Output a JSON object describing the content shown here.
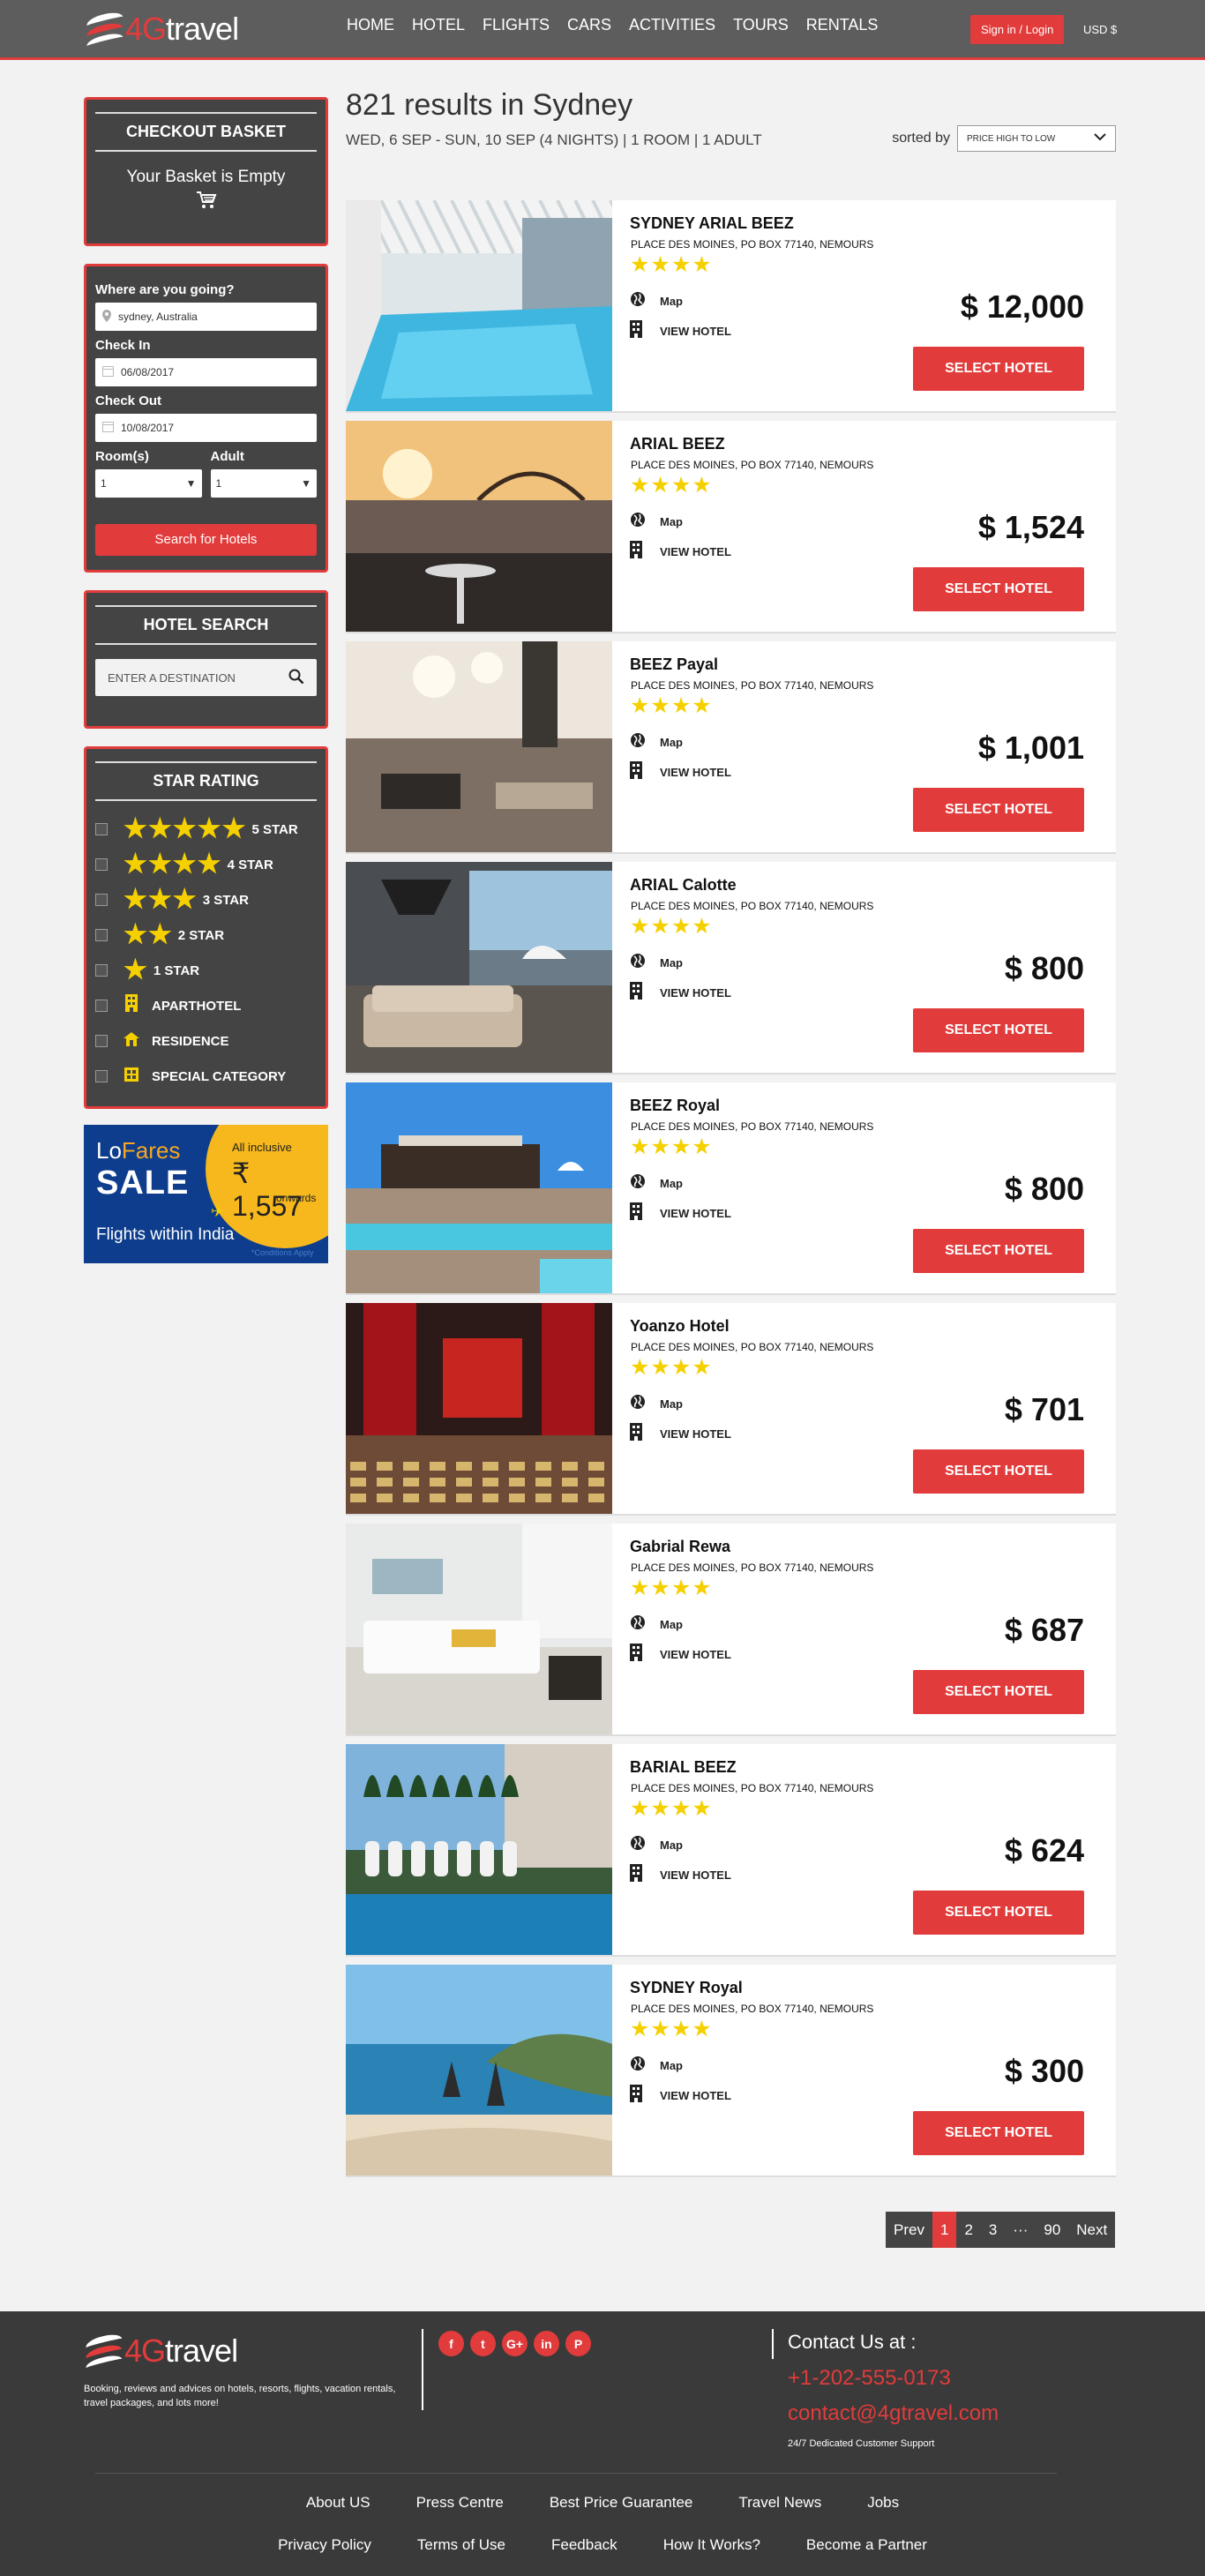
{
  "header": {
    "logo_prefix": "4G",
    "logo_suffix": "travel",
    "nav": [
      "HOME",
      "HOTEL",
      "FLIGHTS",
      "CARS",
      "ACTIVITIES",
      "TOURS",
      "RENTALS"
    ],
    "signin": "Sign in / Login",
    "currency": "USD $"
  },
  "basket": {
    "title": "CHECKOUT BASKET",
    "empty": "Your Basket is Empty"
  },
  "search": {
    "where_label": "Where are you going?",
    "where_value": "sydney, Australia",
    "checkin_label": "Check In",
    "checkin_value": "06/08/2017",
    "checkout_label": "Check Out",
    "checkout_value": "10/08/2017",
    "rooms_label": "Room(s)",
    "rooms_value": "1",
    "adult_label": "Adult",
    "adult_value": "1",
    "button": "Search for Hotels"
  },
  "hotel_search": {
    "title": "HOTEL SEARCH",
    "placeholder": "ENTER A DESTINATION"
  },
  "star_rating": {
    "title": "STAR RATING",
    "options": [
      {
        "label": "5 STAR",
        "stars": "★★★★★"
      },
      {
        "label": "4 STAR",
        "stars": "★★★★"
      },
      {
        "label": "3 STAR",
        "stars": "★★★"
      },
      {
        "label": "2 STAR",
        "stars": "★★"
      },
      {
        "label": "1 STAR",
        "stars": "★"
      }
    ],
    "categories": [
      {
        "label": "APARTHOTEL",
        "icon": "building-icon"
      },
      {
        "label": "RESIDENCE",
        "icon": "house-icon"
      },
      {
        "label": "SPECIAL CATEGORY",
        "icon": "grid-icon"
      }
    ]
  },
  "ad": {
    "brand_lo": "Lo",
    "brand_fares": "Fares",
    "sale": "SALE",
    "inclusive": "All inclusive",
    "price": "₹ 1,557",
    "onwards": "onwards",
    "subtitle": "Flights within India",
    "conditions": "*Conditions Apply"
  },
  "results": {
    "title": "821 results in Sydney",
    "subtitle": "WED, 6 SEP - SUN, 10 SEP (4 NIGHTS)  | 1 ROOM | 1 ADULT",
    "sort_label": "sorted by",
    "sort_value": "PRICE HIGH TO LOW"
  },
  "hotels": [
    {
      "name": "SYDNEY ARIAL BEEZ",
      "address": "PLACE DES MOINES, PO BOX 77140, NEMOURS",
      "rating": 4,
      "price": "$ 12,000"
    },
    {
      "name": "ARIAL BEEZ",
      "address": "PLACE DES MOINES, PO BOX 77140, NEMOURS",
      "rating": 4,
      "price": "$ 1,524"
    },
    {
      "name": "BEEZ Payal",
      "address": "PLACE DES MOINES, PO BOX 77140, NEMOURS",
      "rating": 4,
      "price": "$ 1,001"
    },
    {
      "name": "ARIAL Calotte",
      "address": "PLACE DES MOINES, PO BOX 77140, NEMOURS",
      "rating": 4,
      "price": "$ 800"
    },
    {
      "name": "BEEZ Royal",
      "address": "PLACE DES MOINES, PO BOX 77140, NEMOURS",
      "rating": 4,
      "price": "$ 800"
    },
    {
      "name": "Yoanzo Hotel",
      "address": "PLACE DES MOINES, PO BOX 77140, NEMOURS",
      "rating": 4,
      "price": "$ 701"
    },
    {
      "name": "Gabrial Rewa",
      "address": "PLACE DES MOINES, PO BOX 77140, NEMOURS",
      "rating": 4,
      "price": "$ 687"
    },
    {
      "name": "BARIAL BEEZ",
      "address": "PLACE DES MOINES, PO BOX 77140, NEMOURS",
      "rating": 4,
      "price": "$ 624"
    },
    {
      "name": "SYDNEY Royal",
      "address": "PLACE DES MOINES, PO BOX 77140, NEMOURS",
      "rating": 4,
      "price": "$ 300"
    }
  ],
  "hotel_labels": {
    "map": "Map",
    "view": "VIEW HOTEL",
    "select": "SELECT HOTEL"
  },
  "pagination": {
    "prev": "Prev",
    "pages": [
      "1",
      "2",
      "3"
    ],
    "ellipsis": "···",
    "last": "90",
    "next": "Next"
  },
  "footer": {
    "tagline": "Booking, reviews and advices on hotels, resorts, flights, vacation rentals, travel packages, and lots more!",
    "social": [
      "f",
      "t",
      "G+",
      "in",
      "P"
    ],
    "contact_title": "Contact Us at :",
    "phone": "+1-202-555-0173",
    "email": "contact@4gtravel.com",
    "support": "24/7 Dedicated Customer Support",
    "links_row1": [
      "About US",
      "Press Centre",
      "Best Price Guarantee",
      "Travel News",
      "Jobs"
    ],
    "links_row2": [
      "Privacy Policy",
      "Terms of Use",
      "Feedback",
      "How It Works?",
      "Become a Partner"
    ]
  },
  "colors": {
    "accent": "#e23b3b",
    "header_bg": "#5d5d5d",
    "panel_bg": "#444444",
    "star": "#f5d000",
    "footer_bg": "#3a3a3a"
  }
}
